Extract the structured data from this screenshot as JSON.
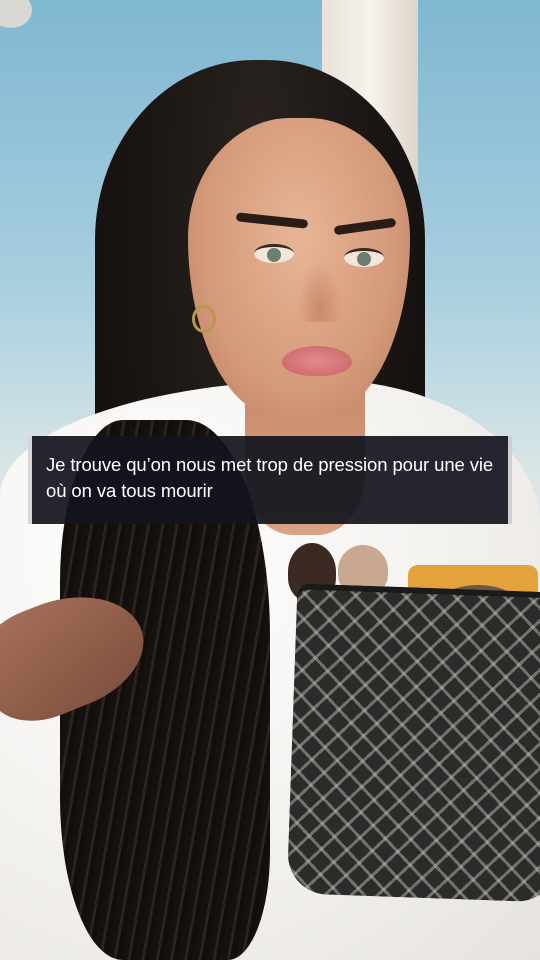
{
  "video": {
    "caption": "Je trouve qu’on nous met trop de pression pour une vie où on va tous mourir"
  },
  "colors": {
    "caption_background": "#12141e",
    "caption_text": "#ffffff",
    "sky_top": "#7fb7d2",
    "robe": "#f3f1ee"
  }
}
